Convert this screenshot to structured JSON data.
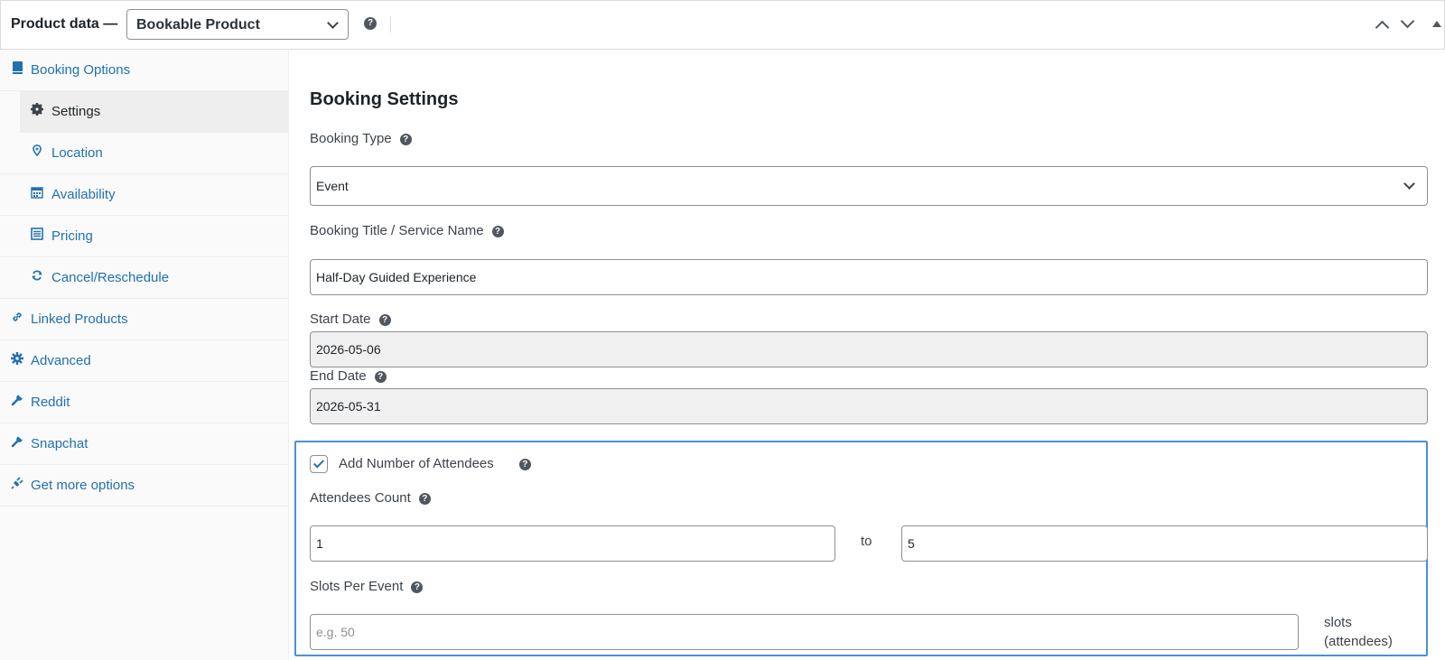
{
  "header": {
    "title": "Product data —",
    "product_type": "Bookable Product",
    "help_glyph": "?"
  },
  "sidebar": {
    "items": [
      {
        "label": "Booking Options",
        "icon": "book-icon"
      },
      {
        "label": "Settings",
        "icon": "gear-icon"
      },
      {
        "label": "Location",
        "icon": "location-pin-icon"
      },
      {
        "label": "Availability",
        "icon": "calendar-icon"
      },
      {
        "label": "Pricing",
        "icon": "list-icon"
      },
      {
        "label": "Cancel/Reschedule",
        "icon": "refresh-icon"
      },
      {
        "label": "Linked Products",
        "icon": "link-icon"
      },
      {
        "label": "Advanced",
        "icon": "gear-icon"
      },
      {
        "label": "Reddit",
        "icon": "wrench-icon"
      },
      {
        "label": "Snapchat",
        "icon": "wrench-icon"
      },
      {
        "label": "Get more options",
        "icon": "plugin-icon"
      }
    ]
  },
  "main": {
    "section_title": "Booking Settings",
    "booking_type": {
      "label": "Booking Type",
      "value": "Event"
    },
    "booking_title": {
      "label": "Booking Title / Service Name",
      "value": "Half-Day Guided Experience"
    },
    "start_date": {
      "label": "Start Date",
      "value": "2026-05-06"
    },
    "end_date": {
      "label": "End Date",
      "value": "2026-05-31"
    },
    "attendees": {
      "checkbox_label": "Add Number of Attendees",
      "checked": true,
      "count_label": "Attendees Count",
      "min_value": "1",
      "to_label": "to",
      "max_value": "5",
      "slots_label": "Slots Per Event",
      "slots_placeholder": "e.g. 50",
      "slots_suffix": "slots (attendees)"
    }
  },
  "colors": {
    "link": "#2271b1",
    "highlight_border": "#4a90d9",
    "readonly_bg": "#f0f0f1"
  }
}
